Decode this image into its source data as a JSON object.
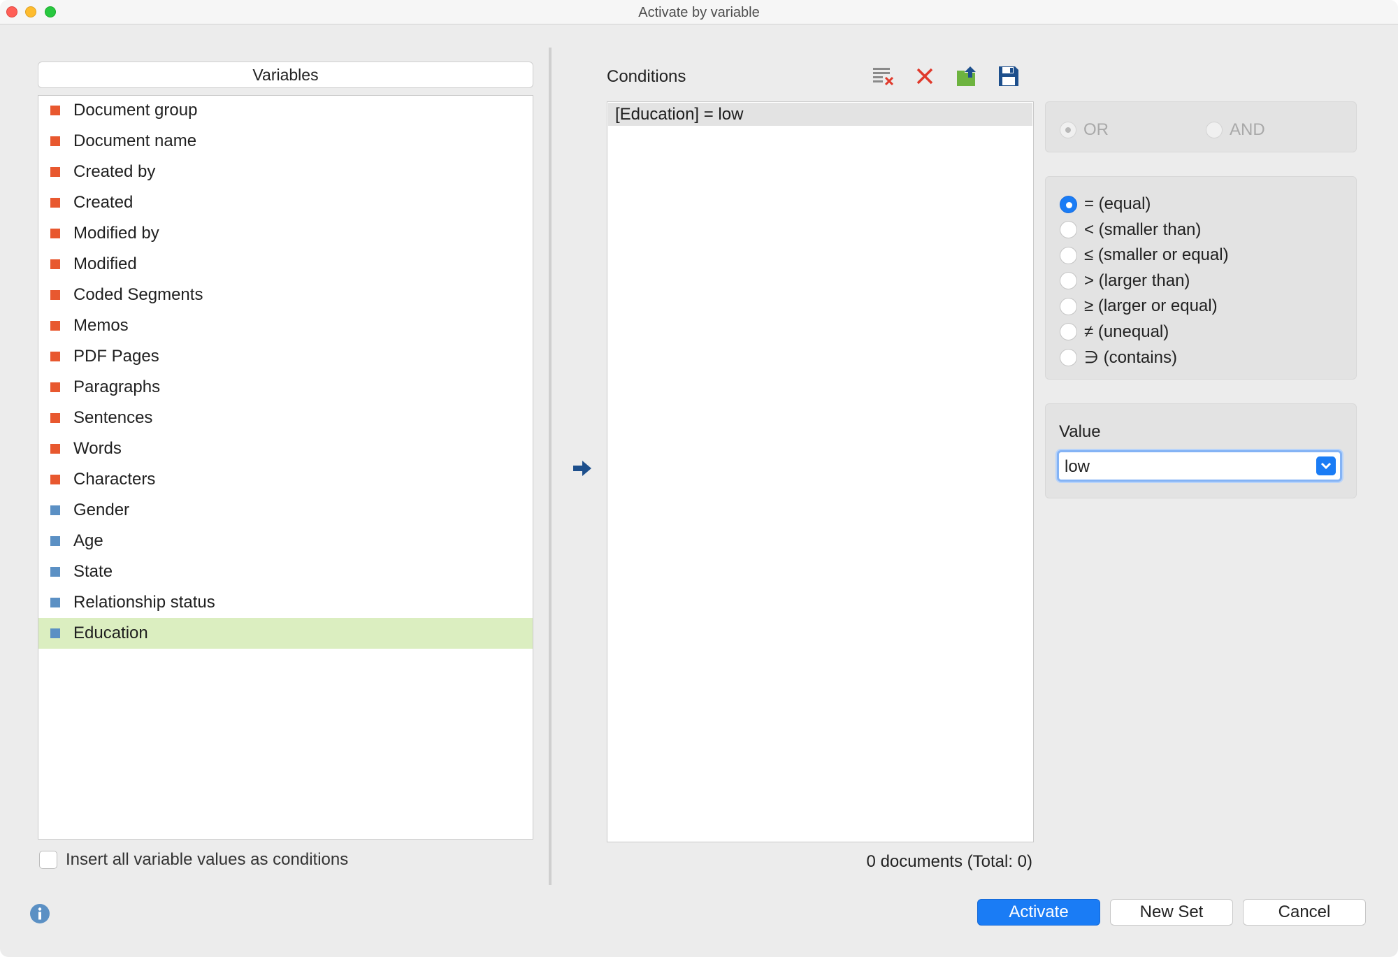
{
  "window": {
    "title": "Activate by variable"
  },
  "variables": {
    "header": "Variables",
    "items": [
      {
        "label": "Document group",
        "color": "#e8582f",
        "kind": "system"
      },
      {
        "label": "Document name",
        "color": "#e8582f",
        "kind": "system"
      },
      {
        "label": "Created by",
        "color": "#e8582f",
        "kind": "system"
      },
      {
        "label": "Created",
        "color": "#e8582f",
        "kind": "system"
      },
      {
        "label": "Modified by",
        "color": "#e8582f",
        "kind": "system"
      },
      {
        "label": "Modified",
        "color": "#e8582f",
        "kind": "system"
      },
      {
        "label": "Coded Segments",
        "color": "#e8582f",
        "kind": "system"
      },
      {
        "label": "Memos",
        "color": "#e8582f",
        "kind": "system"
      },
      {
        "label": "PDF Pages",
        "color": "#e8582f",
        "kind": "system"
      },
      {
        "label": "Paragraphs",
        "color": "#e8582f",
        "kind": "system"
      },
      {
        "label": "Sentences",
        "color": "#e8582f",
        "kind": "system"
      },
      {
        "label": "Words",
        "color": "#e8582f",
        "kind": "system"
      },
      {
        "label": "Characters",
        "color": "#e8582f",
        "kind": "system"
      },
      {
        "label": "Gender",
        "color": "#5b90c4",
        "kind": "user"
      },
      {
        "label": "Age",
        "color": "#5b90c4",
        "kind": "user"
      },
      {
        "label": "State",
        "color": "#5b90c4",
        "kind": "user"
      },
      {
        "label": "Relationship status",
        "color": "#5b90c4",
        "kind": "user"
      },
      {
        "label": "Education",
        "color": "#5b90c4",
        "kind": "user",
        "selected": true
      }
    ],
    "insert_all_label": "Insert all variable values as conditions"
  },
  "conditions": {
    "title": "Conditions",
    "toolbar_icons": [
      "clear-list-icon",
      "delete-icon",
      "export-icon",
      "save-icon"
    ],
    "items": [
      "[Education] = low"
    ],
    "count_text": "0 documents (Total: 0)"
  },
  "logic": {
    "options": [
      {
        "label": "OR",
        "selected": true
      },
      {
        "label": "AND",
        "selected": false
      }
    ]
  },
  "operators": [
    {
      "label": "= (equal)",
      "selected": true
    },
    {
      "label": "< (smaller than)",
      "selected": false
    },
    {
      "label": "≤ (smaller or equal)",
      "selected": false
    },
    {
      "label": "> (larger than)",
      "selected": false
    },
    {
      "label": "≥ (larger or equal)",
      "selected": false
    },
    {
      "label": "≠ (unequal)",
      "selected": false
    },
    {
      "label": "∋ (contains)",
      "selected": false
    }
  ],
  "value": {
    "label": "Value",
    "selected": "low"
  },
  "buttons": {
    "activate": "Activate",
    "new_set": "New Set",
    "cancel": "Cancel"
  },
  "colors": {
    "accent": "#1a7cf5",
    "system_var": "#e8582f",
    "user_var": "#5b90c4",
    "selection": "#dbeec0"
  }
}
